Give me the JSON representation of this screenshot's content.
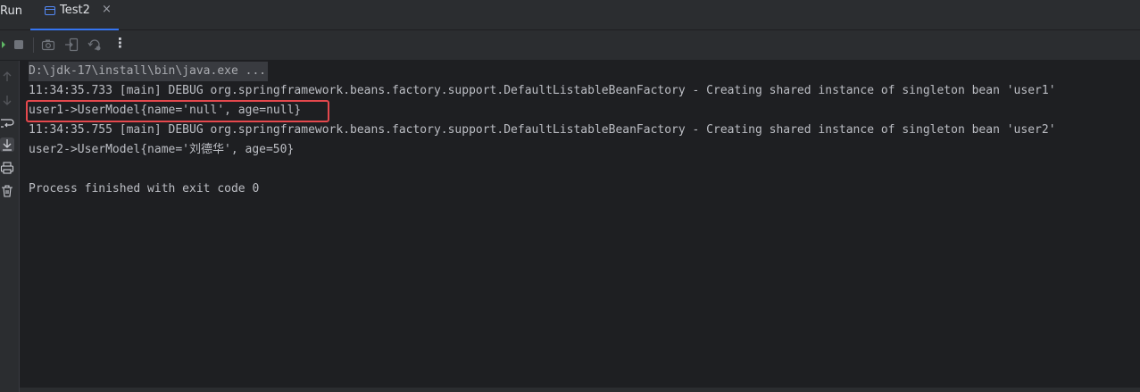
{
  "header": {
    "run_label": "Run",
    "tab": {
      "label": "Test2",
      "close_glyph": "×",
      "icon": "console-window-icon"
    }
  },
  "toolbar": {
    "more_glyph": "⋮",
    "buttons": [
      "rerun-icon",
      "stop-icon",
      "screenshot-icon",
      "login-icon",
      "restore-layout-icon",
      "more-icon"
    ]
  },
  "gutter": {
    "buttons": [
      "scroll-up-icon",
      "scroll-down-icon",
      "soft-wrap-icon",
      "scroll-to-end-icon",
      "print-icon",
      "clear-all-icon"
    ]
  },
  "console": {
    "lines": [
      "D:\\jdk-17\\install\\bin\\java.exe ...",
      "11:34:35.733 [main] DEBUG org.springframework.beans.factory.support.DefaultListableBeanFactory - Creating shared instance of singleton bean 'user1'",
      "user1->UserModel{name='null', age=null}",
      "11:34:35.755 [main] DEBUG org.springframework.beans.factory.support.DefaultListableBeanFactory - Creating shared instance of singleton bean 'user2'",
      "user2->UserModel{name='刘德华', age=50}",
      "",
      "Process finished with exit code 0"
    ]
  },
  "colors": {
    "accent": "#3574f0",
    "highlight": "#e5484d",
    "console_bg": "#1e1f22",
    "panel_bg": "#2b2d30",
    "text": "#bcbec4"
  }
}
